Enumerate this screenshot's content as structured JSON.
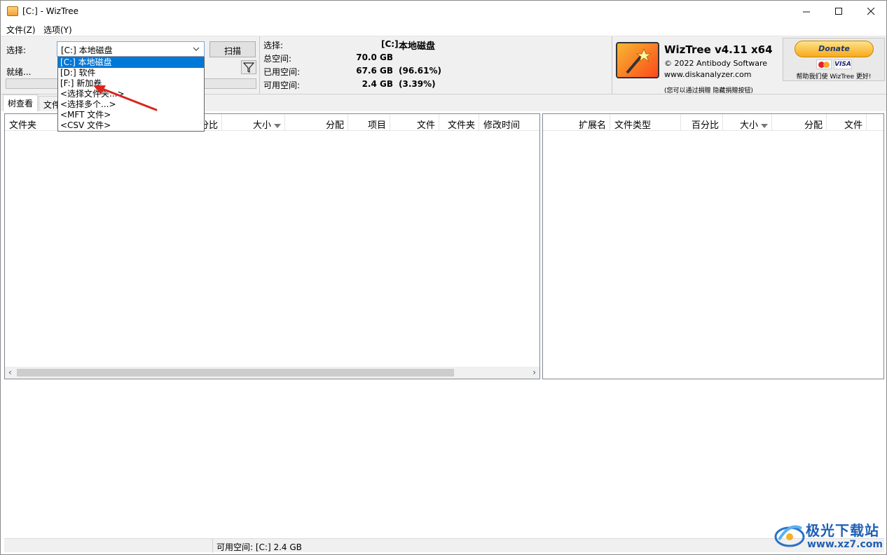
{
  "window": {
    "title": "[C:]  - WizTree"
  },
  "menu": {
    "file": "文件(Z)",
    "options": "选项(Y)"
  },
  "toolbar": {
    "select_label": "选择:",
    "selected_drive": "[C:] 本地磁盘",
    "scan_button": "扫描",
    "status": "就绪...",
    "progress": 0
  },
  "dropdown": {
    "options": [
      "[C:] 本地磁盘",
      "[D:] 软件",
      "[F:] 新加卷",
      "<选择文件夹...>",
      "<选择多个...>",
      "<MFT 文件>",
      "<CSV 文件>"
    ],
    "selected_index": 0
  },
  "info": {
    "select_label": "选择:",
    "drive_letter": "[C:]",
    "drive_name": "本地磁盘",
    "total_label": "总空间:",
    "total_value": "70.0 GB",
    "used_label": "已用空间:",
    "used_value": "67.6 GB",
    "used_percent": "(96.61%)",
    "free_label": "可用空间:",
    "free_value": "2.4 GB",
    "free_percent": "(3.39%)"
  },
  "brand": {
    "title": "WizTree v4.11 x64",
    "copyright": "© 2022 Antibody Software",
    "url": "www.diskanalyzer.com",
    "note": "(您可以通过捐赠 隐藏捐赠按钮)"
  },
  "donate": {
    "button": "Donate",
    "visa": "VISA",
    "text": "帮助我们使 WizTree 更好!"
  },
  "tabs": [
    "树查看",
    "文件"
  ],
  "left_columns": [
    "文件夹",
    "分比",
    "大小",
    "分配",
    "项目",
    "文件",
    "文件夹",
    "修改时间"
  ],
  "right_columns": [
    "扩展名",
    "文件类型",
    "百分比",
    "大小",
    "分配",
    "文件"
  ],
  "statusbar": {
    "free_space": "可用空间: [C:] 2.4 GB"
  },
  "watermark": {
    "name": "极光下载站",
    "url": "www.xz7.com"
  },
  "colors": {
    "selection": "#0078d7",
    "annotation_arrow": "#d9261c",
    "donate": "#f7a91d"
  }
}
